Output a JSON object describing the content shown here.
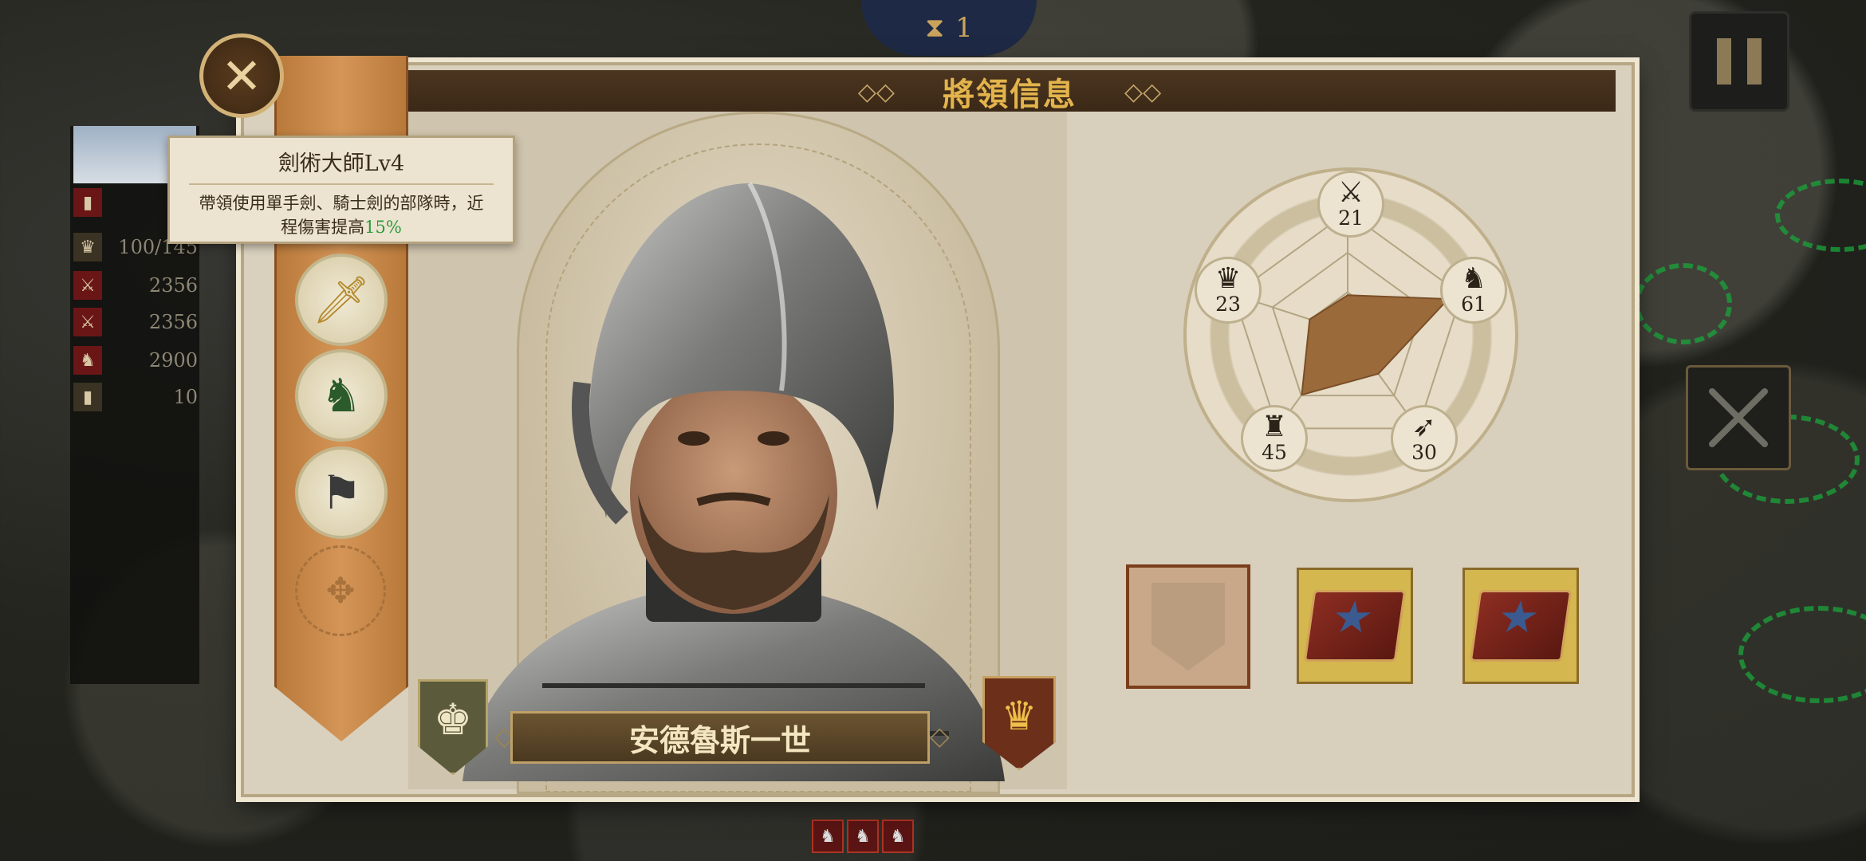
{
  "window": {
    "title": "將領信息"
  },
  "turn": {
    "value": "1"
  },
  "army": {
    "stats": [
      {
        "icon": "boot-icon",
        "value": ""
      },
      {
        "icon": "helmet-icon",
        "value": "100/145"
      },
      {
        "icon": "sword-icon",
        "value": "2356"
      },
      {
        "icon": "sword-icon",
        "value": "2356"
      },
      {
        "icon": "horse-icon",
        "value": "2900"
      },
      {
        "icon": "boot-icon",
        "value": "10"
      }
    ]
  },
  "tooltip": {
    "title": "劍術大師Lv4",
    "body_line1": "帶領使用單手劍、騎士劍的部隊時，近",
    "body_line2_prefix": "程傷害提高",
    "body_pct": "15%"
  },
  "general": {
    "name": "安德魯斯一世"
  },
  "stats": {
    "attack": "21",
    "cavalry": "61",
    "archery": "30",
    "infantry": "45",
    "command": "23"
  },
  "chart_data": {
    "type": "radar",
    "axes": [
      "attack",
      "cavalry",
      "archery",
      "infantry",
      "command"
    ],
    "values": [
      21,
      61,
      30,
      45,
      23
    ],
    "max": 100
  },
  "colors": {
    "title": "#e3b44c",
    "skill_pct": "#2d9a3a",
    "radar_fill": "#9a6a3a"
  }
}
